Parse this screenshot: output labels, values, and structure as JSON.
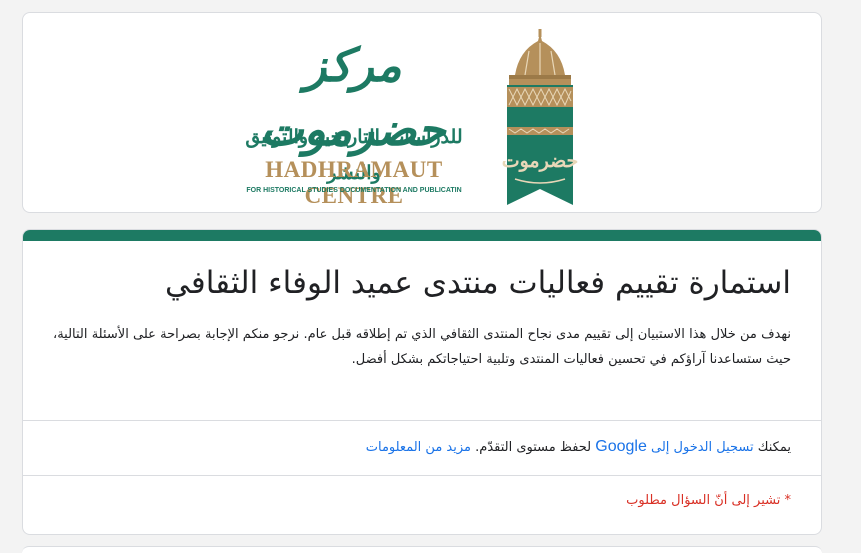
{
  "logo": {
    "arabic_name": "مركز حضرموت",
    "arabic_subtitle": "للدراسات التاريخية والتوثيق والنشر",
    "english_name": "HADHRAMAUT CENTRE",
    "english_subtitle": "FOR HISTORICAL STUDIES DOCUMENTATION AND PUBLICATIN",
    "emblem_text": "حضرموت",
    "colors": {
      "green": "#1d7a63",
      "gold": "#b5905b"
    }
  },
  "form": {
    "accent_color": "#1d7a63",
    "title": "استمارة تقييم فعاليات منتدى عميد الوفاء الثقافي",
    "description": "نهدف من خلال هذا الاستبيان إلى تقييم مدى نجاح المنتدى الثقافي الذي تم إطلاقه قبل عام. نرجو منكم الإجابة بصراحة على الأسئلة التالية، حيث ستساعدنا آراؤكم في تحسين فعاليات المنتدى وتلبية احتياجاتكم بشكل أفضل.",
    "signin": {
      "prefix": "يمكنك",
      "link_part1": "تسجيل الدخول إلى",
      "link_google": "Google",
      "middle": "لحفظ مستوى التقدّم.",
      "learn_more": "مزيد من المعلومات"
    },
    "required_note": "* تشير إلى أنّ السؤال مطلوب"
  }
}
